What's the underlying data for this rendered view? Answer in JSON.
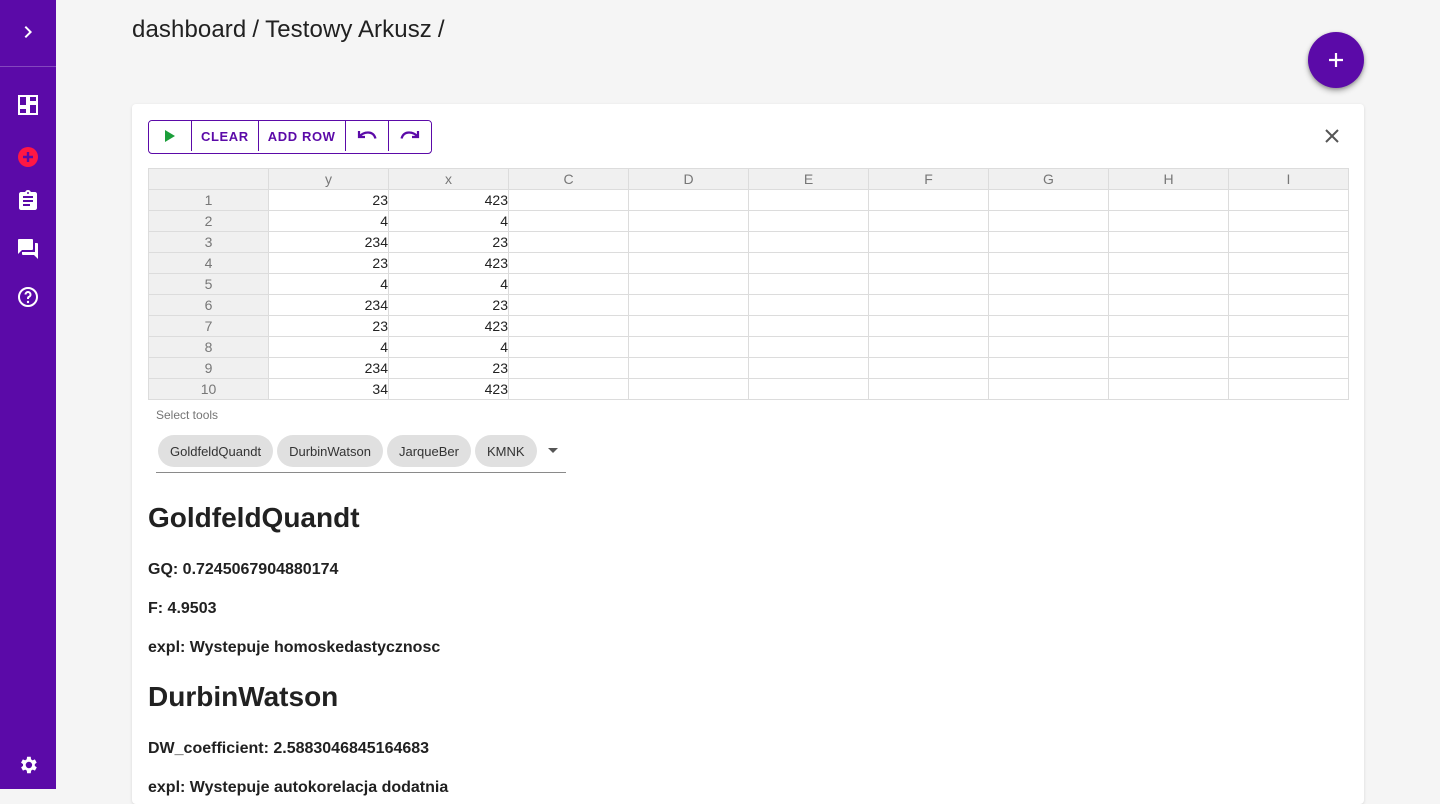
{
  "breadcrumb": {
    "items": [
      "dashboard",
      "Testowy Arkusz"
    ],
    "separator": "/"
  },
  "sidebar": {
    "items": [
      {
        "icon": "chevron-right-icon"
      },
      {
        "icon": "dashboard-icon"
      },
      {
        "icon": "add-circle-icon"
      },
      {
        "icon": "assignment-icon"
      },
      {
        "icon": "forum-icon"
      },
      {
        "icon": "help-icon"
      },
      {
        "icon": "settings-icon"
      }
    ]
  },
  "toolbar": {
    "run_icon": "play-icon",
    "clear_label": "CLEAR",
    "add_row_label": "ADD ROW",
    "undo_icon": "undo-icon",
    "redo_icon": "redo-icon"
  },
  "spreadsheet": {
    "columns": [
      "y",
      "x",
      "C",
      "D",
      "E",
      "F",
      "G",
      "H",
      "I"
    ],
    "rows": [
      {
        "num": "1",
        "cells": [
          "23",
          "423",
          "",
          "",
          "",
          "",
          "",
          "",
          ""
        ]
      },
      {
        "num": "2",
        "cells": [
          "4",
          "4",
          "",
          "",
          "",
          "",
          "",
          "",
          ""
        ]
      },
      {
        "num": "3",
        "cells": [
          "234",
          "23",
          "",
          "",
          "",
          "",
          "",
          "",
          ""
        ]
      },
      {
        "num": "4",
        "cells": [
          "23",
          "423",
          "",
          "",
          "",
          "",
          "",
          "",
          ""
        ]
      },
      {
        "num": "5",
        "cells": [
          "4",
          "4",
          "",
          "",
          "",
          "",
          "",
          "",
          ""
        ]
      },
      {
        "num": "6",
        "cells": [
          "234",
          "23",
          "",
          "",
          "",
          "",
          "",
          "",
          ""
        ]
      },
      {
        "num": "7",
        "cells": [
          "23",
          "423",
          "",
          "",
          "",
          "",
          "",
          "",
          ""
        ]
      },
      {
        "num": "8",
        "cells": [
          "4",
          "4",
          "",
          "",
          "",
          "",
          "",
          "",
          ""
        ]
      },
      {
        "num": "9",
        "cells": [
          "234",
          "23",
          "",
          "",
          "",
          "",
          "",
          "",
          ""
        ]
      },
      {
        "num": "10",
        "cells": [
          "34",
          "423",
          "",
          "",
          "",
          "",
          "",
          "",
          ""
        ]
      }
    ]
  },
  "tools": {
    "label": "Select tools",
    "selected": [
      "GoldfeldQuandt",
      "DurbinWatson",
      "JarqueBer",
      "KMNK"
    ]
  },
  "results": {
    "goldfeld": {
      "title": "GoldfeldQuandt",
      "gq": "GQ: 0.7245067904880174",
      "f": "F: 4.9503",
      "expl": "expl: Wystepuje homoskedastycznosc"
    },
    "durbin": {
      "title": "DurbinWatson",
      "dw": "DW_coefficient: 2.5883046845164683",
      "expl": "expl: Wystepuje autokorelacja dodatnia"
    }
  },
  "colors": {
    "primary": "#5b0aa8",
    "accent_red": "#ff1744",
    "run_green": "#1b9e3a"
  }
}
